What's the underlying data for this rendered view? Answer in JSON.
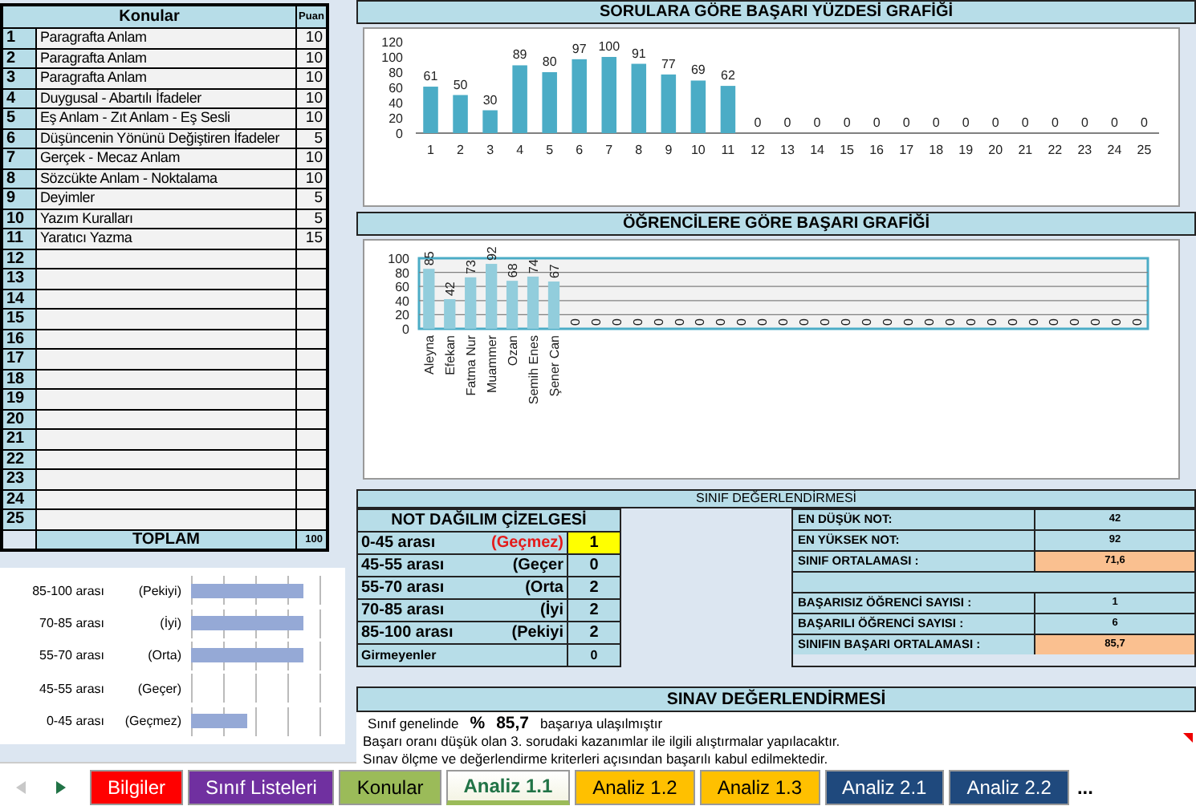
{
  "topics": {
    "header": "Konular",
    "points_header": "Puan",
    "rows": [
      {
        "no": "1",
        "topic": "Paragrafta Anlam",
        "points": "10"
      },
      {
        "no": "2",
        "topic": "Paragrafta Anlam",
        "points": "10"
      },
      {
        "no": "3",
        "topic": "Paragrafta Anlam",
        "points": "10"
      },
      {
        "no": "4",
        "topic": "Duygusal - Abartılı İfadeler",
        "points": "10"
      },
      {
        "no": "5",
        "topic": "Eş Anlam - Zıt Anlam - Eş Sesli",
        "points": "10"
      },
      {
        "no": "6",
        "topic": "Düşüncenin Yönünü Değiştiren İfadeler",
        "points": "5"
      },
      {
        "no": "7",
        "topic": "Gerçek - Mecaz Anlam",
        "points": "10"
      },
      {
        "no": "8",
        "topic": "Sözcükte Anlam - Noktalama",
        "points": "10"
      },
      {
        "no": "9",
        "topic": "Deyimler",
        "points": "5"
      },
      {
        "no": "10",
        "topic": "Yazım Kuralları",
        "points": "5"
      },
      {
        "no": "11",
        "topic": "Yaratıcı Yazma",
        "points": "15"
      },
      {
        "no": "12"
      },
      {
        "no": "13"
      },
      {
        "no": "14"
      },
      {
        "no": "15"
      },
      {
        "no": "16"
      },
      {
        "no": "17"
      },
      {
        "no": "18"
      },
      {
        "no": "19"
      },
      {
        "no": "20"
      },
      {
        "no": "21"
      },
      {
        "no": "22"
      },
      {
        "no": "23"
      },
      {
        "no": "24"
      },
      {
        "no": "25"
      }
    ],
    "total_label": "TOPLAM",
    "total": "100"
  },
  "distribution_chart": {
    "rows": [
      {
        "range": "85-100 arası",
        "grade": "(Pekiyi)"
      },
      {
        "range": "70-85 arası",
        "grade": "(İyi)"
      },
      {
        "range": "55-70 arası",
        "grade": "(Orta)"
      },
      {
        "range": "45-55 arası",
        "grade": "(Geçer)"
      },
      {
        "range": "0-45 arası",
        "grade": "(Geçmez)"
      }
    ]
  },
  "question_chart": {
    "title": "SORULARA GÖRE BAŞARI YÜZDESİ GRAFİĞİ",
    "chart_data": {
      "type": "bar",
      "categories": [
        "1",
        "2",
        "3",
        "4",
        "5",
        "6",
        "7",
        "8",
        "9",
        "10",
        "11",
        "12",
        "13",
        "14",
        "15",
        "16",
        "17",
        "18",
        "19",
        "20",
        "21",
        "22",
        "23",
        "24",
        "25"
      ],
      "values": [
        61,
        50,
        30,
        89,
        80,
        97,
        100,
        91,
        77,
        69,
        62,
        0,
        0,
        0,
        0,
        0,
        0,
        0,
        0,
        0,
        0,
        0,
        0,
        0,
        0
      ],
      "ylim": [
        0,
        120
      ],
      "yticks": [
        0,
        20,
        40,
        60,
        80,
        100,
        120
      ],
      "data_labels": true
    }
  },
  "student_chart": {
    "title": "ÖĞRENCİLERE GÖRE BAŞARI GRAFİĞİ",
    "chart_data": {
      "type": "bar",
      "categories": [
        "Aleyna",
        "Efekan",
        "Fatma Nur",
        "Muammer",
        "Ozan",
        "Semih Enes",
        "Şener Can",
        null,
        null,
        null,
        null,
        null,
        null,
        null,
        null,
        null,
        null,
        null,
        null,
        null,
        null,
        null,
        null,
        null,
        null,
        null,
        null,
        null,
        null,
        null,
        null,
        null,
        null,
        null,
        null
      ],
      "values": [
        85,
        42,
        73,
        92,
        68,
        74,
        67,
        0,
        0,
        0,
        0,
        0,
        0,
        0,
        0,
        0,
        0,
        0,
        0,
        0,
        0,
        0,
        0,
        0,
        0,
        0,
        0,
        0,
        0,
        0,
        0,
        0,
        0,
        0,
        0
      ],
      "ylim": [
        0,
        100
      ],
      "yticks": [
        0,
        20,
        40,
        60,
        80,
        100
      ],
      "grid": true,
      "data_labels": true
    }
  },
  "class_evaluation": {
    "title": "SINIF DEĞERLENDİRMESİ",
    "distribution": {
      "title": "NOT DAĞILIM ÇİZELGESİ",
      "rows": [
        {
          "kind": "grade",
          "range": "0-45 arası",
          "grade": "(Geçmez)",
          "count": "1",
          "failing": true,
          "highlight": true
        },
        {
          "kind": "grade",
          "range": "45-55 arası",
          "grade": "(Geçer",
          "count": "0",
          "failing": false,
          "highlight": false
        },
        {
          "kind": "grade",
          "range": "55-70 arası",
          "grade": "(Orta",
          "count": "2",
          "failing": false,
          "highlight": false
        },
        {
          "kind": "grade",
          "range": "70-85 arası",
          "grade": "(İyi",
          "count": "2",
          "failing": false,
          "highlight": false
        },
        {
          "kind": "grade",
          "range": "85-100 arası",
          "grade": "(Pekiyi",
          "count": "2",
          "failing": false,
          "highlight": false
        },
        {
          "kind": "absent",
          "range": "Girmeyenler",
          "count": "0",
          "highlight": false
        }
      ]
    },
    "stats": [
      {
        "kind": "stat",
        "label": "EN DÜŞÜK NOT:",
        "value": "42",
        "highlight": false
      },
      {
        "kind": "stat",
        "label": "EN YÜKSEK NOT:",
        "value": "92",
        "highlight": false
      },
      {
        "kind": "stat",
        "label": "SINIF ORTALAMASI :",
        "value": "71,6",
        "highlight": true
      },
      {
        "kind": "blank"
      },
      {
        "kind": "stat",
        "label": "BAŞARISIZ ÖĞRENCİ SAYISI :",
        "value": "1",
        "highlight": false
      },
      {
        "kind": "stat",
        "label": "BAŞARILI ÖĞRENCİ SAYISI :",
        "value": "6",
        "highlight": false
      },
      {
        "kind": "stat",
        "label": "SINIFIN BAŞARI ORTALAMASI :",
        "value": "85,7",
        "highlight": true
      }
    ]
  },
  "exam_evaluation": {
    "title": "SINAV DEĞERLENDİRMESİ",
    "summary": {
      "prefix": "Sınıf genelinde",
      "percent_sign": "%",
      "percent": "85,7",
      "suffix": "başarıya ulaşılmıştır"
    },
    "lines": [
      "Başarı oranı düşük olan 3. sorudaki kazanımlar ile ilgili alıştırmalar yapılacaktır.",
      "Sınav ölçme ve değerlendirme kriterleri açısından başarılı kabul edilmektedir."
    ],
    "has_comment": true
  },
  "sheet_tabs": [
    {
      "label": "Bilgiler",
      "color": "#ff0000",
      "selected": false
    },
    {
      "label": "Sınıf Listeleri",
      "color": "#7030a0",
      "selected": false
    },
    {
      "label": "Konular",
      "color": "#9bbb59",
      "selected": false
    },
    {
      "label": "Analiz 1.1",
      "color": "#9bbb59",
      "selected": true
    },
    {
      "label": "Analiz 1.2",
      "color": "#ffc000",
      "selected": false
    },
    {
      "label": "Analiz 1.3",
      "color": "#ffc000",
      "selected": false
    },
    {
      "label": "Analiz 2.1",
      "color": "#1f497d",
      "selected": false
    },
    {
      "label": "Analiz 2.2",
      "color": "#1f497d",
      "selected": false
    }
  ],
  "more_tabs": "..."
}
